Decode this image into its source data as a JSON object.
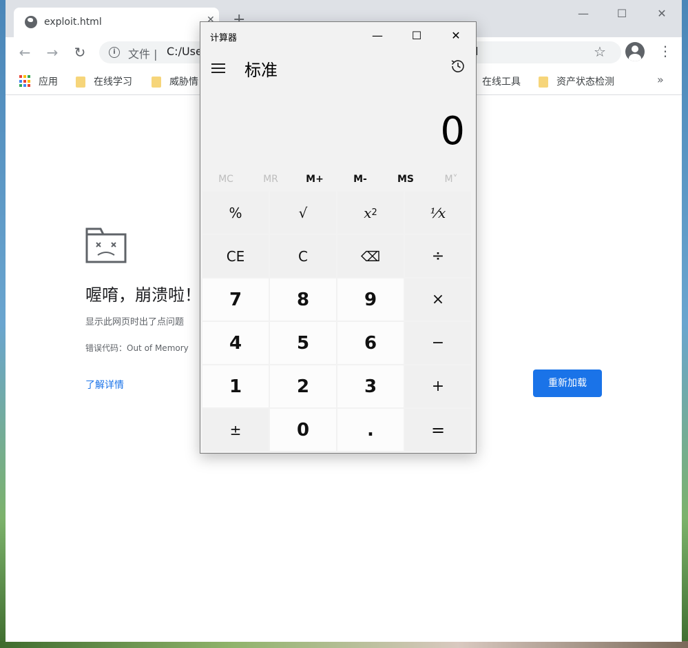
{
  "browser": {
    "tab_title": "exploit.html",
    "tab_close": "✕",
    "new_tab": "+",
    "window_controls": {
      "minimize": "—",
      "maximize": "☐",
      "close": "✕"
    },
    "nav": {
      "back": "←",
      "forward": "→",
      "reload": "↻"
    },
    "omnibox": {
      "info": "i",
      "scheme": "文件 |",
      "url": "C:/Use",
      "url_tail": "nl"
    },
    "star": "☆",
    "menu": "⋮",
    "bookmarks": {
      "apps": "应用",
      "items": [
        "在线学习",
        "威胁情",
        "在线工具",
        "资产状态检测"
      ],
      "more": "»"
    }
  },
  "crash_page": {
    "title": "喔唷，崩溃啦！",
    "description": "显示此网页时出了点问题",
    "error_code": "错误代码：Out of Memory",
    "learn_more": "了解详情",
    "reload": "重新加载"
  },
  "calculator": {
    "window_title": "计算器",
    "window_controls": {
      "minimize": "—",
      "maximize": "☐",
      "close": "✕"
    },
    "mode": "标准",
    "display": "0",
    "memory": [
      "MC",
      "MR",
      "M+",
      "M-",
      "MS",
      "M˅"
    ],
    "keys": {
      "percent": "%",
      "sqrt": "√",
      "square_base": "x",
      "square_exp": "2",
      "reciprocal": "⅟x",
      "ce": "CE",
      "c": "C",
      "backspace": "⌫",
      "divide": "÷",
      "seven": "7",
      "eight": "8",
      "nine": "9",
      "multiply": "×",
      "four": "4",
      "five": "5",
      "six": "6",
      "minus": "−",
      "one": "1",
      "two": "2",
      "three": "3",
      "plus": "+",
      "negate": "±",
      "zero": "0",
      "decimal": ".",
      "equals": "="
    }
  }
}
